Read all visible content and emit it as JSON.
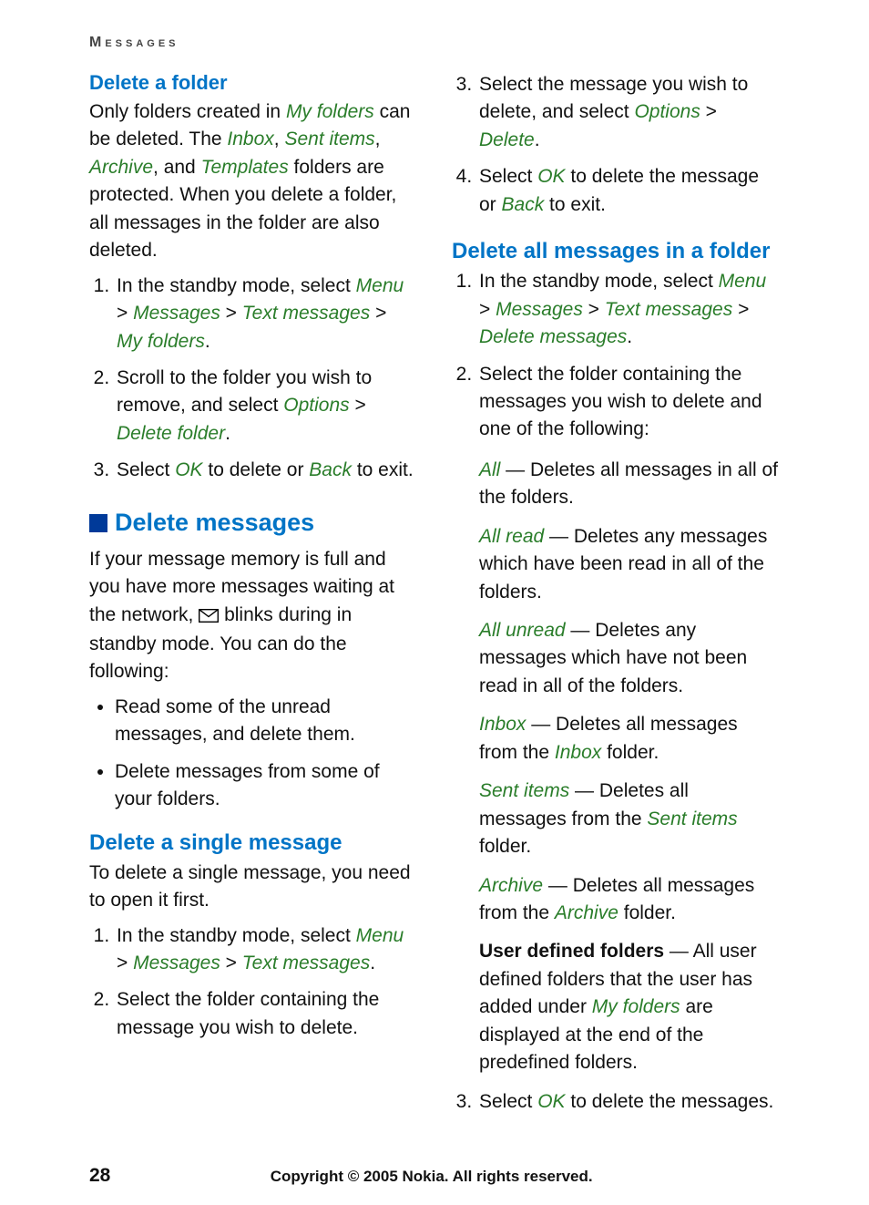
{
  "header": {
    "running": "Messages"
  },
  "left": {
    "h_delete_folder": "Delete a folder",
    "para1_a": "Only folders created in ",
    "para1_my_folders": "My folders",
    "para1_b": " can be deleted. The ",
    "para1_inbox": "Inbox",
    "para1_c": ", ",
    "para1_sent": "Sent items",
    "para1_d": ", ",
    "para1_archive": "Archive",
    "para1_e": ", and ",
    "para1_templates": "Templates",
    "para1_f": " folders are protected. When you delete a folder, all messages in the folder are also deleted.",
    "step_df_1a": "In the standby mode, select ",
    "step_df_1_menu": "Menu",
    "gt": " > ",
    "step_df_1_messages": "Messages",
    "step_df_1_text": "Text messages",
    "step_df_1_myf": "My folders",
    "period": ".",
    "step_df_2a": "Scroll to the folder you wish to remove, and select ",
    "step_df_2_opt": "Options",
    "step_df_2_del": "Delete folder",
    "step_df_3a": "Select ",
    "step_df_3_ok": "OK",
    "step_df_3b": " to delete or ",
    "step_df_3_back": "Back",
    "step_df_3c": " to exit.",
    "h_delete_messages": "Delete messages",
    "para2_a": "If your message memory is full and you have more messages waiting at the network, ",
    "para2_b": " blinks during in standby mode. You can do the following:",
    "bul1": "Read some of the unread messages, and delete them.",
    "bul2": "Delete messages from some of your folders.",
    "h_delete_single": "Delete a single message",
    "para3": "To delete a single message, you need to open it first.",
    "step_s_1a": "In the standby mode, select ",
    "step_s_1_menu": "Menu",
    "step_s_1_messages": "Messages",
    "step_s_1_text": "Text messages",
    "step_s_2": "Select the folder containing the message you wish to delete."
  },
  "right": {
    "step_s_3a": "Select the message you wish to delete, and select ",
    "step_s_3_opt": "Options",
    "step_s_3_del": "Delete",
    "step_s_4a": "Select ",
    "step_s_4_ok": "OK",
    "step_s_4b": " to delete the message or ",
    "step_s_4_back": "Back",
    "step_s_4c": " to exit.",
    "h_delete_all": "Delete all messages in a folder",
    "step_da_1a": "In the standby mode, select ",
    "step_da_1_menu": "Menu",
    "step_da_1_messages": "Messages",
    "step_da_1_text": "Text messages",
    "step_da_1_del": "Delete messages",
    "step_da_2": "Select the folder containing the messages you wish to delete and one of the following:",
    "opt_all": "All",
    "opt_all_t": " — Deletes all messages in all of the folders.",
    "opt_allread": "All read",
    "opt_allread_t": " — Deletes any messages which have been read in all of the folders.",
    "opt_allunread": "All unread",
    "opt_allunread_t": " — Deletes any messages which have not been read in all of the folders.",
    "opt_inbox": "Inbox",
    "opt_inbox_t_a": " — Deletes all messages from the ",
    "opt_inbox_t_b": "Inbox",
    "opt_inbox_t_c": " folder.",
    "opt_sent": "Sent items",
    "opt_sent_t_a": " — Deletes all messages from the ",
    "opt_sent_t_b": "Sent items",
    "opt_sent_t_c": " folder.",
    "opt_archive": "Archive",
    "opt_archive_t_a": " — Deletes all messages from the ",
    "opt_archive_t_b": "Archive",
    "opt_archive_t_c": " folder.",
    "opt_user": "User defined folders",
    "opt_user_t_a": " — All user defined folders that the user has added under ",
    "opt_user_t_b": "My folders",
    "opt_user_t_c": " are displayed at the end of the predefined folders.",
    "step_da_3a": "Select ",
    "step_da_3_ok": "OK",
    "step_da_3b": " to delete the messages."
  },
  "footer": {
    "page": "28",
    "copyright": "Copyright © 2005 Nokia. All rights reserved."
  }
}
